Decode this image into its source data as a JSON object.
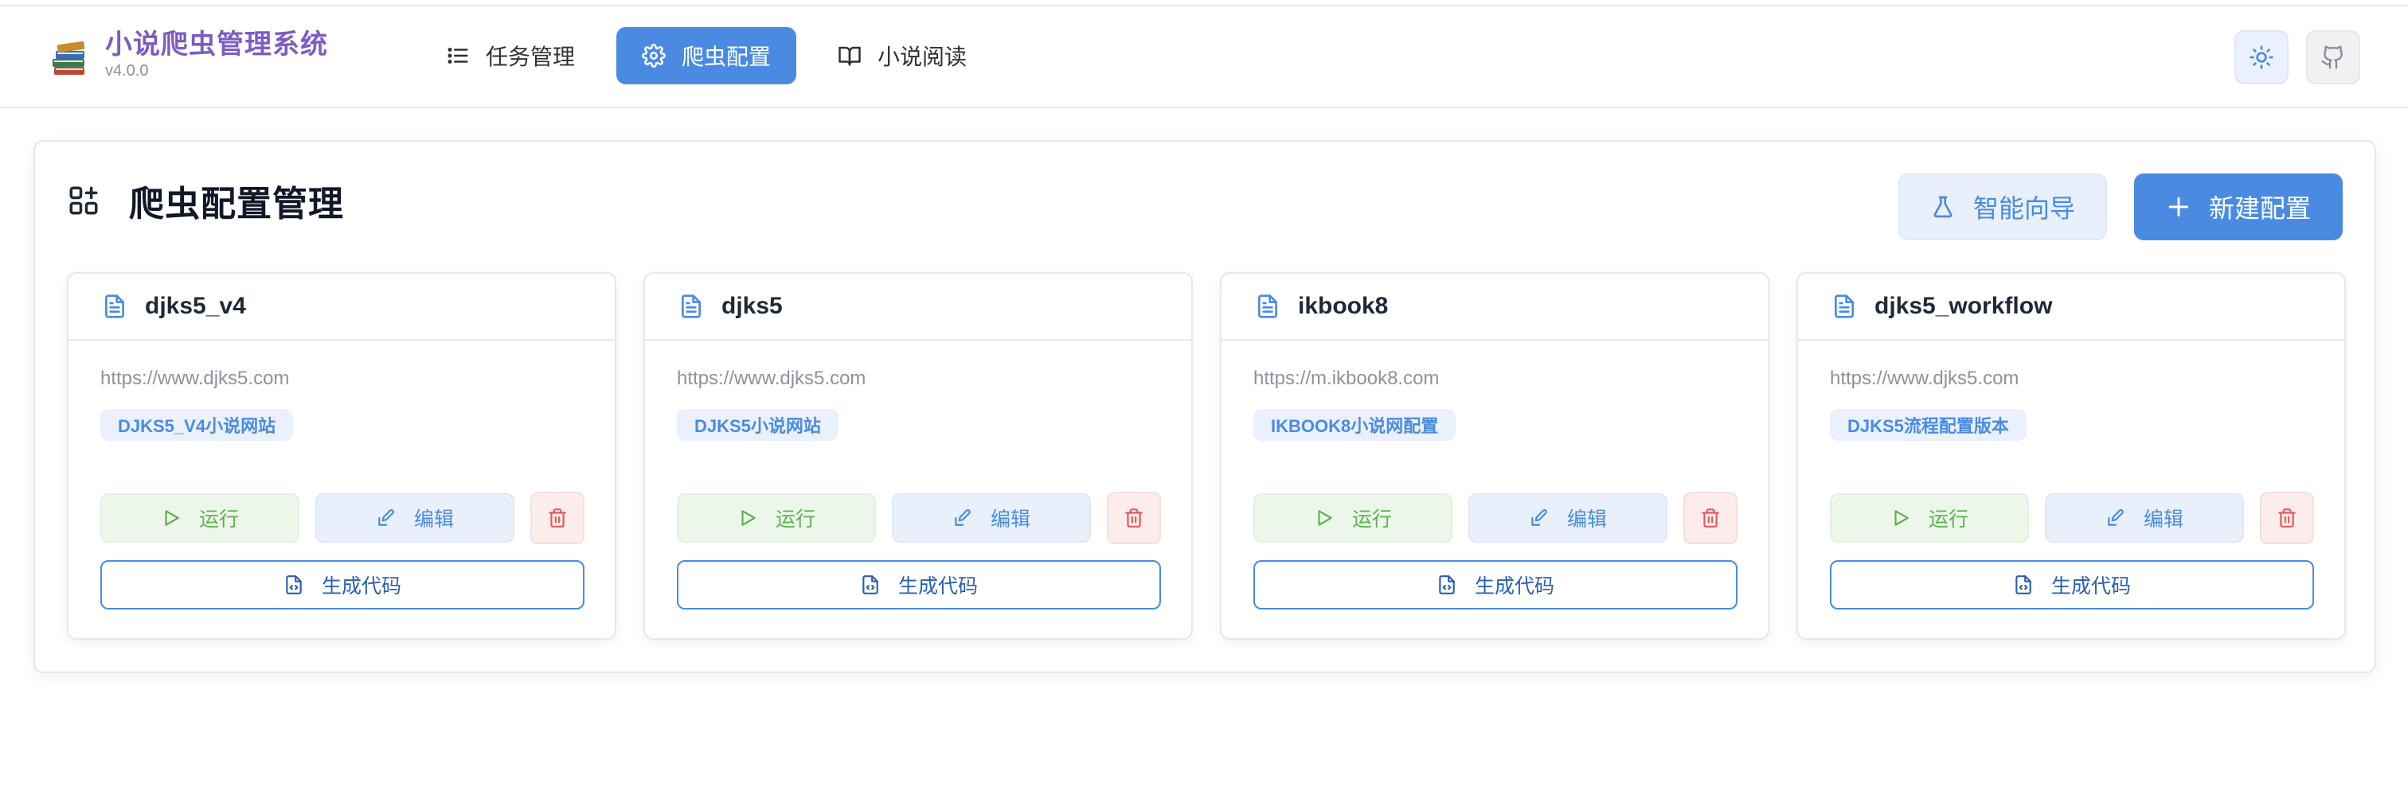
{
  "app": {
    "title": "小说爬虫管理系统",
    "version": "v4.0.0"
  },
  "nav": {
    "items": [
      {
        "label": "任务管理",
        "icon": "list-icon",
        "active": false
      },
      {
        "label": "爬虫配置",
        "icon": "gear-icon",
        "active": true
      },
      {
        "label": "小说阅读",
        "icon": "book-open-icon",
        "active": false
      }
    ]
  },
  "header_buttons": {
    "theme_icon": "sun-icon",
    "repo_icon": "github-icon"
  },
  "panel": {
    "title": "爬虫配置管理",
    "icon": "apps-grid-icon",
    "wizard_label": "智能向导",
    "new_label": "新建配置"
  },
  "cards": [
    {
      "name": "djks5_v4",
      "url": "https://www.djks5.com",
      "tag": "DJKS5_V4小说网站",
      "run": "运行",
      "edit": "编辑",
      "generate": "生成代码"
    },
    {
      "name": "djks5",
      "url": "https://www.djks5.com",
      "tag": "DJKS5小说网站",
      "run": "运行",
      "edit": "编辑",
      "generate": "生成代码"
    },
    {
      "name": "ikbook8",
      "url": "https://m.ikbook8.com",
      "tag": "IKBOOK8小说网配置",
      "run": "运行",
      "edit": "编辑",
      "generate": "生成代码"
    },
    {
      "name": "djks5_workflow",
      "url": "https://www.djks5.com",
      "tag": "DJKS5流程配置版本",
      "run": "运行",
      "edit": "编辑",
      "generate": "生成代码"
    }
  ],
  "colors": {
    "primary": "#4a8be1",
    "brand_text": "#7c5cc4",
    "success": "#5eb04e",
    "danger": "#e05a5a"
  }
}
